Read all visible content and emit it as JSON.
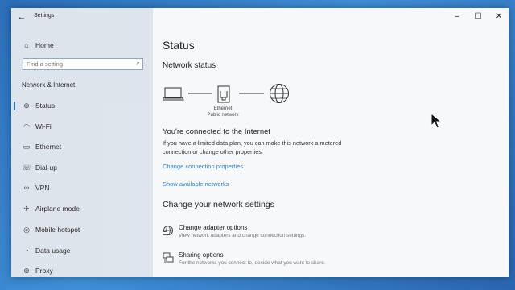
{
  "window": {
    "title": "Settings"
  },
  "controls": {
    "minimize": "–",
    "maximize": "☐",
    "close": "✕",
    "back": "←"
  },
  "sidebar": {
    "home": "Home",
    "search_placeholder": "Find a setting",
    "section": "Network & Internet",
    "items": [
      {
        "label": "Status",
        "icon": "globe-status-icon",
        "glyph": "⊕"
      },
      {
        "label": "Wi-Fi",
        "icon": "wifi-icon",
        "glyph": "◠"
      },
      {
        "label": "Ethernet",
        "icon": "ethernet-icon",
        "glyph": "▭"
      },
      {
        "label": "Dial-up",
        "icon": "dialup-icon",
        "glyph": "☏"
      },
      {
        "label": "VPN",
        "icon": "vpn-icon",
        "glyph": "∞"
      },
      {
        "label": "Airplane mode",
        "icon": "airplane-icon",
        "glyph": "✈"
      },
      {
        "label": "Mobile hotspot",
        "icon": "hotspot-icon",
        "glyph": "◎"
      },
      {
        "label": "Data usage",
        "icon": "data-usage-icon",
        "glyph": "◔"
      },
      {
        "label": "Proxy",
        "icon": "proxy-icon",
        "glyph": "⊕"
      }
    ]
  },
  "main": {
    "title": "Status",
    "network_status": "Network status",
    "diagram": {
      "adapter": "Ethernet",
      "network": "Public network"
    },
    "connected": "You're connected to the Internet",
    "description": "If you have a limited data plan, you can make this network a metered connection or change other properties.",
    "link_properties": "Change connection properties",
    "link_networks": "Show available networks",
    "change_heading": "Change your network settings",
    "options": [
      {
        "title": "Change adapter options",
        "desc": "View network adapters and change connection settings."
      },
      {
        "title": "Sharing options",
        "desc": "For the networks you connect to, decide what you want to share."
      }
    ]
  },
  "colors": {
    "accent": "#1f6dbf",
    "link": "#2f80c8",
    "sidebar_bg": "#dde4ec"
  }
}
